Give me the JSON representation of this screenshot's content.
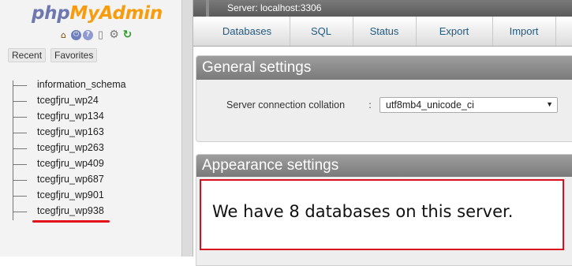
{
  "logo": {
    "part1": "php",
    "part2": "MyAdmin"
  },
  "quick_icons": [
    "home-icon",
    "exit-icon",
    "help-icon",
    "docs-icon",
    "settings-icon",
    "reload-icon"
  ],
  "nav_tabs": {
    "recent": "Recent",
    "favorites": "Favorites"
  },
  "databases": [
    "information_schema",
    "tcegfjru_wp24",
    "tcegfjru_wp134",
    "tcegfjru_wp163",
    "tcegfjru_wp263",
    "tcegfjru_wp409",
    "tcegfjru_wp687",
    "tcegfjru_wp901",
    "tcegfjru_wp938"
  ],
  "server_bar": {
    "label": "Server: localhost:3306"
  },
  "tabs": [
    "Databases",
    "SQL",
    "Status",
    "Export",
    "Import"
  ],
  "general_settings": {
    "title": "General settings",
    "collation_label": "Server connection collation",
    "collation_value": "utf8mb4_unicode_ci"
  },
  "appearance_settings": {
    "title": "Appearance settings"
  },
  "annotation": "We have 8 databases on this server.",
  "colors": {
    "annotation_border": "#d8101e",
    "link": "#235a81",
    "logo_php": "#6c78af",
    "logo_admin": "#f89c0e"
  }
}
